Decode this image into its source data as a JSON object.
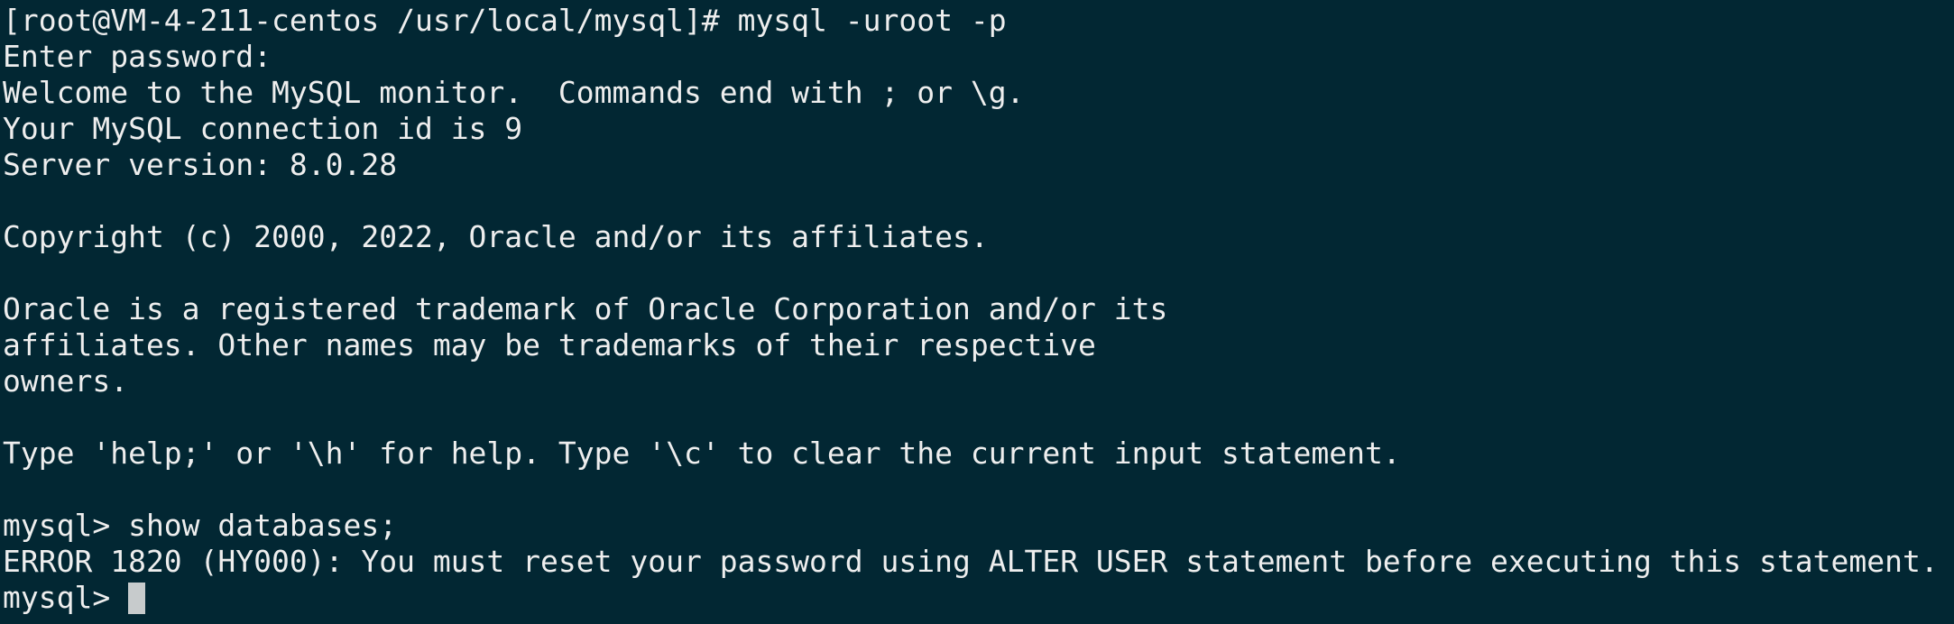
{
  "terminal": {
    "lines": [
      "[root@VM-4-211-centos /usr/local/mysql]# mysql -uroot -p",
      "Enter password:",
      "Welcome to the MySQL monitor.  Commands end with ; or \\g.",
      "Your MySQL connection id is 9",
      "Server version: 8.0.28",
      "",
      "Copyright (c) 2000, 2022, Oracle and/or its affiliates.",
      "",
      "Oracle is a registered trademark of Oracle Corporation and/or its",
      "affiliates. Other names may be trademarks of their respective",
      "owners.",
      "",
      "Type 'help;' or '\\h' for help. Type '\\c' to clear the current input statement.",
      "",
      "mysql> show databases;",
      "ERROR 1820 (HY000): You must reset your password using ALTER USER statement before executing this statement."
    ],
    "prompt": "mysql> ",
    "input_value": ""
  }
}
